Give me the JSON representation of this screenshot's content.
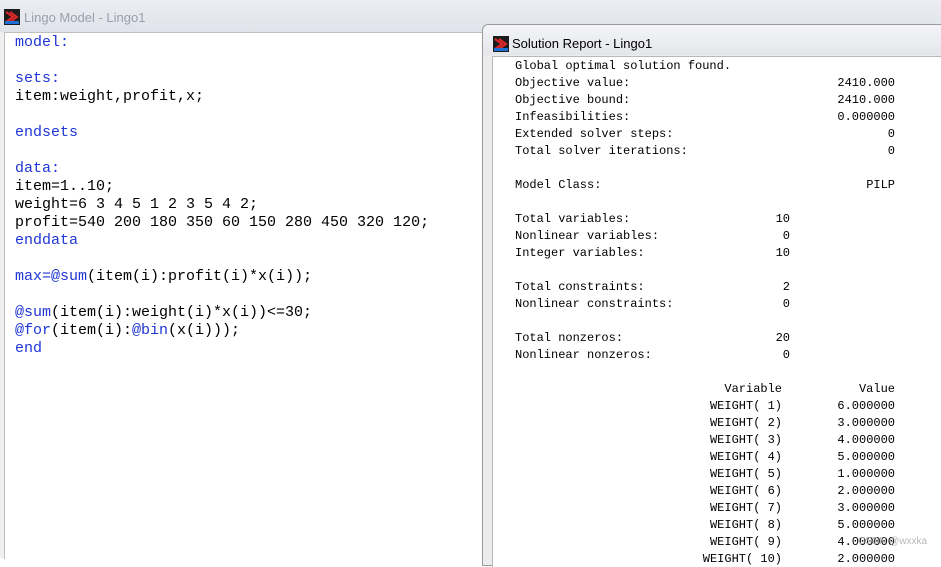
{
  "model_window": {
    "title": "Lingo Model - Lingo1",
    "code_lines": [
      [
        {
          "t": "model:",
          "k": 1
        }
      ],
      [],
      [
        {
          "t": "sets:",
          "k": 1
        }
      ],
      [
        {
          "t": "item:weight,profit,x;",
          "k": 0
        }
      ],
      [],
      [
        {
          "t": "endsets",
          "k": 1
        }
      ],
      [],
      [
        {
          "t": "data:",
          "k": 1
        }
      ],
      [
        {
          "t": "item=1..10;",
          "k": 0
        }
      ],
      [
        {
          "t": "weight=6 3 4 5 1 2 3 5 4 2;",
          "k": 0
        }
      ],
      [
        {
          "t": "profit=540 200 180 350 60 150 280 450 320 120;",
          "k": 0
        }
      ],
      [
        {
          "t": "enddata",
          "k": 1
        }
      ],
      [],
      [
        {
          "t": "max=",
          "k": 1
        },
        {
          "t": "@sum",
          "k": 1
        },
        {
          "t": "(item(i):profit(i)*x(i));",
          "k": 0
        }
      ],
      [],
      [
        {
          "t": "@sum",
          "k": 1
        },
        {
          "t": "(item(i):weight(i)*x(i))<=30;",
          "k": 0
        }
      ],
      [
        {
          "t": "@for",
          "k": 1
        },
        {
          "t": "(item(i):",
          "k": 0
        },
        {
          "t": "@bin",
          "k": 1
        },
        {
          "t": "(x(i)));",
          "k": 0
        }
      ],
      [
        {
          "t": "end",
          "k": 1
        }
      ]
    ]
  },
  "report_window": {
    "title": "Solution Report - Lingo1",
    "status_line": "Global optimal solution found.",
    "summary": [
      {
        "label": "Objective value:",
        "value": "2410.000"
      },
      {
        "label": "Objective bound:",
        "value": "2410.000"
      },
      {
        "label": "Infeasibilities:",
        "value": "0.000000"
      },
      {
        "label": "Extended solver steps:",
        "value": "0"
      },
      {
        "label": "Total solver iterations:",
        "value": "0"
      }
    ],
    "model_class": {
      "label": "Model Class:",
      "value": "PILP"
    },
    "variables": [
      {
        "label": "Total variables:",
        "value": "10"
      },
      {
        "label": "Nonlinear variables:",
        "value": "0"
      },
      {
        "label": "Integer variables:",
        "value": "10"
      }
    ],
    "constraints": [
      {
        "label": "Total constraints:",
        "value": "2"
      },
      {
        "label": "Nonlinear constraints:",
        "value": "0"
      }
    ],
    "nonzeros": [
      {
        "label": "Total nonzeros:",
        "value": "20"
      },
      {
        "label": "Nonlinear nonzeros:",
        "value": "0"
      }
    ],
    "table_headers": {
      "variable": "Variable",
      "value": "Value"
    },
    "table_rows": [
      {
        "variable": "WEIGHT( 1)",
        "value": "6.000000"
      },
      {
        "variable": "WEIGHT( 2)",
        "value": "3.000000"
      },
      {
        "variable": "WEIGHT( 3)",
        "value": "4.000000"
      },
      {
        "variable": "WEIGHT( 4)",
        "value": "5.000000"
      },
      {
        "variable": "WEIGHT( 5)",
        "value": "1.000000"
      },
      {
        "variable": "WEIGHT( 6)",
        "value": "2.000000"
      },
      {
        "variable": "WEIGHT( 7)",
        "value": "3.000000"
      },
      {
        "variable": "WEIGHT( 8)",
        "value": "5.000000"
      },
      {
        "variable": "WEIGHT( 9)",
        "value": "4.000000"
      },
      {
        "variable": "WEIGHT( 10)",
        "value": "2.000000"
      }
    ]
  },
  "watermark": "CSDN @wxxka",
  "colors": {
    "keyword": "#1f35d6",
    "text": "#000000",
    "title_inactive": "#9aa0a8"
  }
}
